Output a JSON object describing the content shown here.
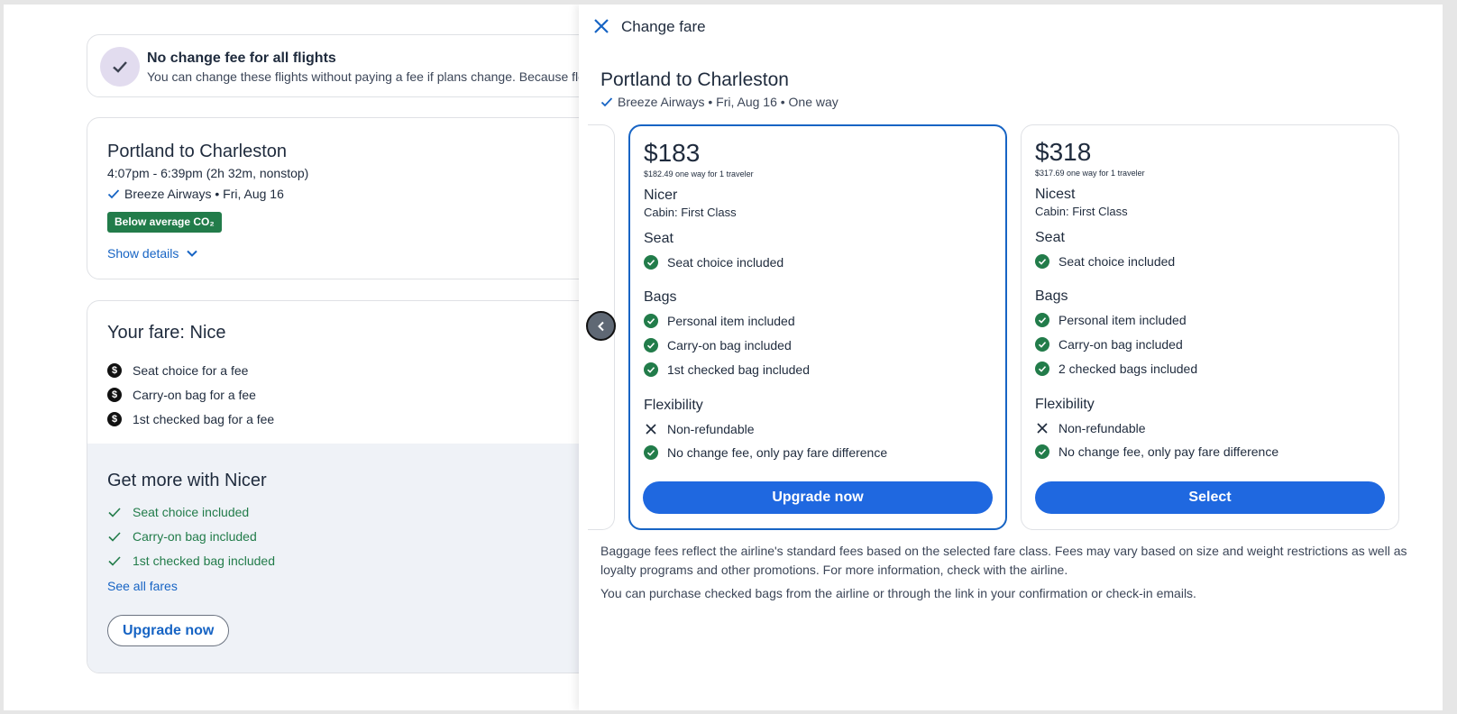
{
  "left": {
    "no_fee": {
      "title": "No change fee for all flights",
      "subtitle": "You can change these flights without paying a fee if plans change. Because flexibi"
    },
    "flight": {
      "title": "Portland to Charleston",
      "time": "4:07pm - 6:39pm (2h 32m, nonstop)",
      "airline": "Breeze Airways • Fri, Aug 16",
      "co2_badge": "Below average CO₂",
      "show_details": "Show details"
    },
    "fare": {
      "title": "Your fare: Nice",
      "items": [
        "Seat choice for a fee",
        "Carry-on bag for a fee",
        "1st checked bag for a fee"
      ]
    },
    "get_more": {
      "title": "Get more with Nicer",
      "items": [
        "Seat choice included",
        "Carry-on bag included",
        "1st checked bag included"
      ],
      "see_all": "See all fares",
      "upgrade": "Upgrade now"
    }
  },
  "panel": {
    "title": "Change fare",
    "route": "Portland to Charleston",
    "subtitle": "Breeze Airways • Fri, Aug 16 • One way",
    "fares": [
      {
        "price": "$183",
        "price_sub": "$182.49 one way for 1 traveler",
        "name": "Nicer",
        "cabin": "Cabin: First Class",
        "seat_heading": "Seat",
        "seat": "Seat choice included",
        "bags_heading": "Bags",
        "bags": [
          "Personal item included",
          "Carry-on bag included",
          "1st checked bag included"
        ],
        "flex_heading": "Flexibility",
        "flex": [
          "Non-refundable",
          "No change fee, only pay fare difference"
        ],
        "button": "Upgrade now"
      },
      {
        "price": "$318",
        "price_sub": "$317.69 one way for 1 traveler",
        "name": "Nicest",
        "cabin": "Cabin: First Class",
        "seat_heading": "Seat",
        "seat": "Seat choice included",
        "bags_heading": "Bags",
        "bags": [
          "Personal item included",
          "Carry-on bag included",
          "2 checked bags included"
        ],
        "flex_heading": "Flexibility",
        "flex": [
          "Non-refundable",
          "No change fee, only pay fare difference"
        ],
        "button": "Select"
      }
    ],
    "note1": "Baggage fees reflect the airline's standard fees based on the selected fare class. Fees may vary based on size and weight restrictions as well as loyalty programs and other promotions. For more information, check with the airline.",
    "note2": "You can purchase checked bags from the airline or through the link in your confirmation or check-in emails."
  },
  "colors": {
    "accent_blue": "#1764c4",
    "button_blue": "#1f68e0",
    "green": "#227c4a",
    "panel_bg": "#eff2f7"
  },
  "icons": [
    "check-circle-icon",
    "check-icon",
    "dollar-icon",
    "chevron-down-icon",
    "close-icon",
    "chevron-left-icon",
    "x-icon",
    "check-badge-icon"
  ]
}
